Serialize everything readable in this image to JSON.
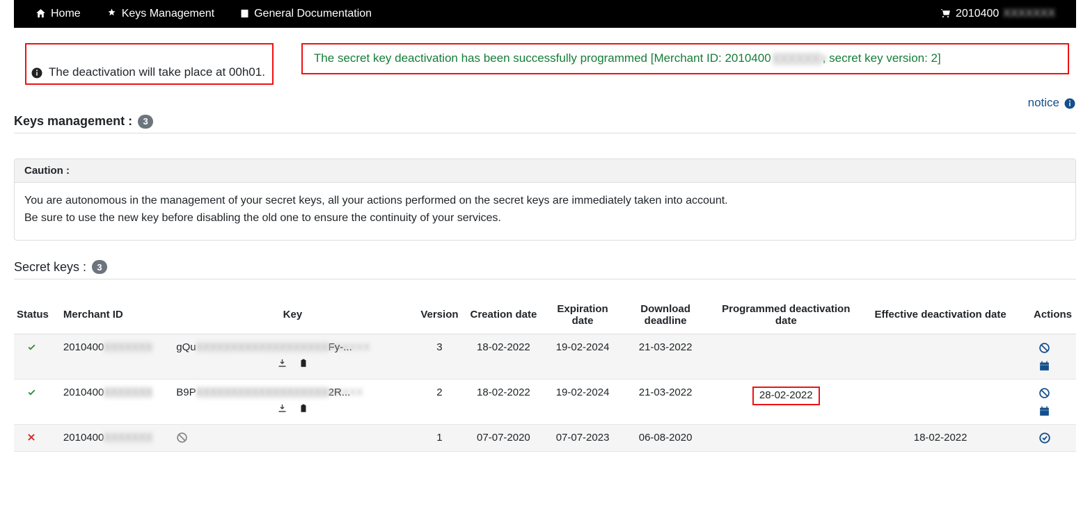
{
  "nav": {
    "home": "Home",
    "keys_mgmt": "Keys Management",
    "docs": "General Documentation",
    "merchant_id": "2010400",
    "merchant_id_blur": "XXXXXXX"
  },
  "info_msg": "The deactivation will take place at 00h01.",
  "success_msg_part1": "The secret key deactivation has been successfully programmed ",
  "success_msg_bracket_pre": "[Merchant ID: 2010400",
  "success_msg_bracket_blur": "XXXXXXX",
  "success_msg_bracket_post": ", secret key version: 2]",
  "notice_label": "notice",
  "keys_mgmt_heading": "Keys management :",
  "keys_mgmt_count": "3",
  "caution_head": "Caution :",
  "caution_body_l1": "You are autonomous in the management of your secret keys, all your actions performed on the secret keys are immediately taken into account.",
  "caution_body_l2": "Be sure to use the new key before disabling the old one to ensure the continuity of your services.",
  "secret_keys_heading": "Secret keys :",
  "secret_keys_count": "3",
  "columns": {
    "status": "Status",
    "merchant": "Merchant ID",
    "key": "Key",
    "version": "Version",
    "creation": "Creation date",
    "expiration": "Expiration date",
    "download": "Download deadline",
    "prog_deact": "Programmed deactivation date",
    "eff_deact": "Effective deactivation date",
    "actions": "Actions"
  },
  "rows": [
    {
      "status": "ok",
      "merchant": "2010400",
      "merchant_blur": "XXXXXXX",
      "key_pre": "gQu",
      "key_blur": "XXXXXXXXXXXXXXXXXXXXXXXXX",
      "key_post": "Fy-...",
      "version": "3",
      "creation": "18-02-2022",
      "expiration": "19-02-2024",
      "download": "21-03-2022",
      "prog_deact": "",
      "prog_highlight": false,
      "eff_deact": "",
      "key_icons": true,
      "actions": [
        "forbid",
        "calendar"
      ]
    },
    {
      "status": "ok",
      "merchant": "2010400",
      "merchant_blur": "XXXXXXX",
      "key_pre": "B9P",
      "key_blur": "XXXXXXXXXXXXXXXXXXXXXXXX",
      "key_post": "2R...",
      "version": "2",
      "creation": "18-02-2022",
      "expiration": "19-02-2024",
      "download": "21-03-2022",
      "prog_deact": "28-02-2022",
      "prog_highlight": true,
      "eff_deact": "",
      "key_icons": true,
      "actions": [
        "forbid",
        "calendar"
      ]
    },
    {
      "status": "x",
      "merchant": "2010400",
      "merchant_blur": "XXXXXXX",
      "key_pre": "",
      "key_blur": "",
      "key_post": "",
      "key_disabled": true,
      "version": "1",
      "creation": "07-07-2020",
      "expiration": "07-07-2023",
      "download": "06-08-2020",
      "prog_deact": "",
      "prog_highlight": false,
      "eff_deact": "18-02-2022",
      "key_icons": false,
      "actions": [
        "check"
      ]
    }
  ]
}
